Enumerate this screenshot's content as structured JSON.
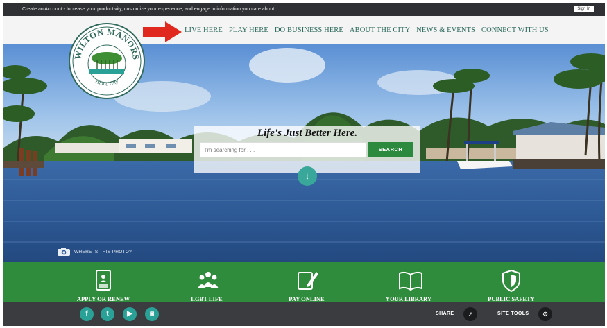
{
  "topbar": {
    "message": "Create an Account - Increase your productivity, customize your experience, and engage in information you care about.",
    "signin": "Sign In"
  },
  "logo": {
    "city_name": "WILTON MANORS",
    "subtitle": "Island City"
  },
  "nav": {
    "items": [
      "LIVE HERE",
      "PLAY HERE",
      "DO BUSINESS HERE",
      "ABOUT THE CITY",
      "NEWS & EVENTS",
      "CONNECT WITH US"
    ]
  },
  "annotation": {
    "arrow_color": "#e0281e"
  },
  "search": {
    "tagline": "Life's Just Better Here.",
    "placeholder": "I'm searching for . . .",
    "button": "SEARCH"
  },
  "hero": {
    "photo_link": "WHERE IS THIS PHOTO?"
  },
  "quick_links": [
    {
      "label": "APPLY OR RENEW",
      "icon": "document-icon"
    },
    {
      "label": "LGBT LIFE",
      "icon": "people-icon"
    },
    {
      "label": "PAY ONLINE",
      "icon": "pay-icon"
    },
    {
      "label": "YOUR LIBRARY",
      "icon": "book-icon"
    },
    {
      "label": "PUBLIC SAFETY",
      "icon": "shield-icon"
    }
  ],
  "footer": {
    "social": [
      {
        "name": "facebook-icon",
        "glyph": "f"
      },
      {
        "name": "twitter-icon",
        "glyph": "t"
      },
      {
        "name": "youtube-icon",
        "glyph": "▶"
      },
      {
        "name": "instagram-icon",
        "glyph": "◙"
      }
    ],
    "share": "SHARE",
    "site_tools": "SITE TOOLS"
  },
  "colors": {
    "green": "#2f8c3c",
    "teal": "#2aa197",
    "nav_text": "#2c6a5c",
    "dark": "#3a3c3f"
  }
}
